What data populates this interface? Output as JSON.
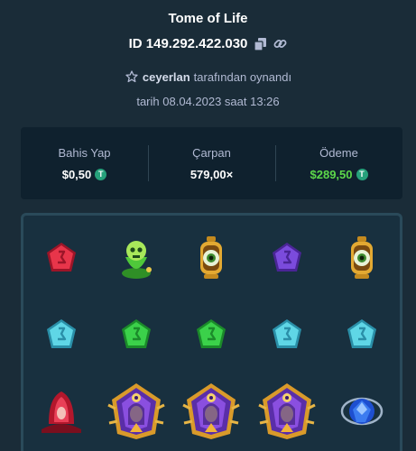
{
  "header": {
    "title": "Tome of Life",
    "bet_id": "ID 149.292.422.030",
    "player_name": "ceyerlan",
    "player_suffix": "tarafından oynandı",
    "date": "tarih 08.04.2023 saat 13:26"
  },
  "stats": {
    "bet_label": "Bahis Yap",
    "bet_value": "$0,50",
    "multiplier_label": "Çarpan",
    "multiplier_value": "579,00×",
    "payout_label": "Ödeme",
    "payout_value": "$289,50",
    "currency_symbol": "T",
    "currency_color": "#26a17b",
    "payout_color": "#5dd84a"
  },
  "board": {
    "rows": [
      [
        "red-rune-gem",
        "green-skull-potion",
        "golden-eye-lantern",
        "purple-rune-gem",
        "golden-eye-lantern"
      ],
      [
        "cyan-rune-gem",
        "green-rune-gem",
        "green-rune-gem",
        "cyan-rune-gem",
        "cyan-rune-gem"
      ],
      [
        "red-witch-portrait",
        "goddess-emblem",
        "goddess-emblem",
        "goddess-emblem",
        "blue-crystal-orb"
      ]
    ]
  }
}
